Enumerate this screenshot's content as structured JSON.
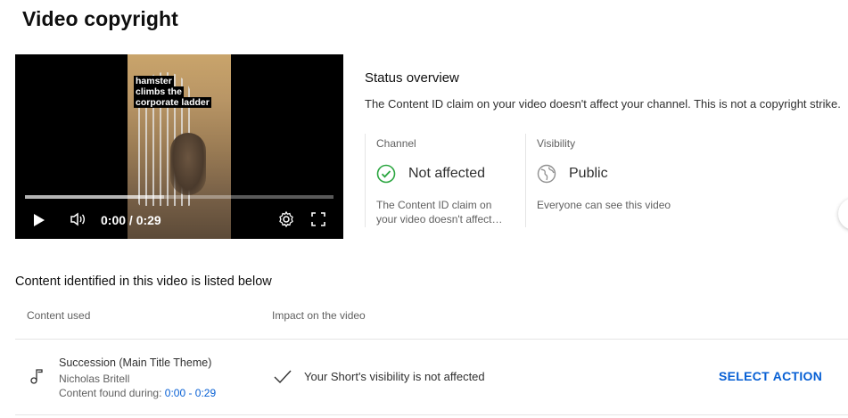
{
  "page": {
    "title": "Video copyright"
  },
  "player": {
    "caption_lines": [
      "hamster",
      "climbs the",
      "corporate ladder"
    ],
    "time": "0:00 / 0:29",
    "buffered_fraction": 0.45
  },
  "status": {
    "title": "Status overview",
    "description": "The Content ID claim on your video doesn't affect your channel. This is not a copyright strike.",
    "channel": {
      "label": "Channel",
      "value": "Not affected",
      "desc_line1": "The Content ID claim on",
      "desc_line2": "your video doesn't affect…",
      "icon": "check-circle-icon",
      "icon_color": "#2ba640"
    },
    "visibility": {
      "label": "Visibility",
      "value": "Public",
      "desc": "Everyone can see this video",
      "icon": "globe-icon"
    }
  },
  "content": {
    "section_title": "Content identified in this video is listed below",
    "headers": {
      "content_used": "Content used",
      "impact": "Impact on the video"
    },
    "items": [
      {
        "title": "Succession (Main Title Theme)",
        "artist": "Nicholas Britell",
        "found_label": "Content found during: ",
        "found_range": "0:00 - 0:29",
        "impact": "Your Short's visibility is not affected",
        "action": "SELECT ACTION",
        "icon": "music-note-icon"
      }
    ]
  },
  "colors": {
    "link": "#065fd4",
    "divider": "#e5e5e5",
    "success": "#2ba640"
  }
}
